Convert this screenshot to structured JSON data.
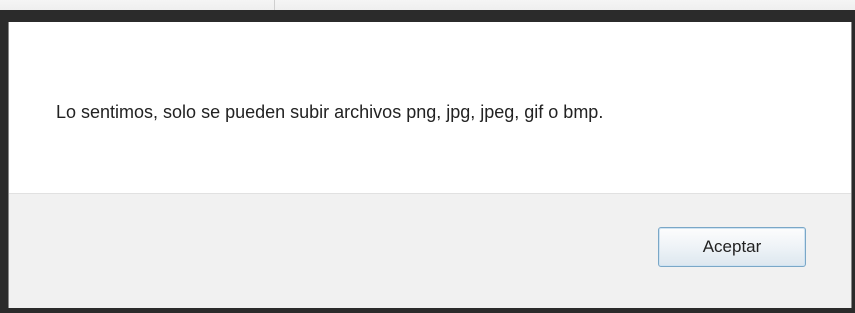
{
  "dialog": {
    "message": "Lo sentimos, solo se pueden subir archivos png, jpg, jpeg, gif o bmp.",
    "accept_label": "Aceptar"
  }
}
